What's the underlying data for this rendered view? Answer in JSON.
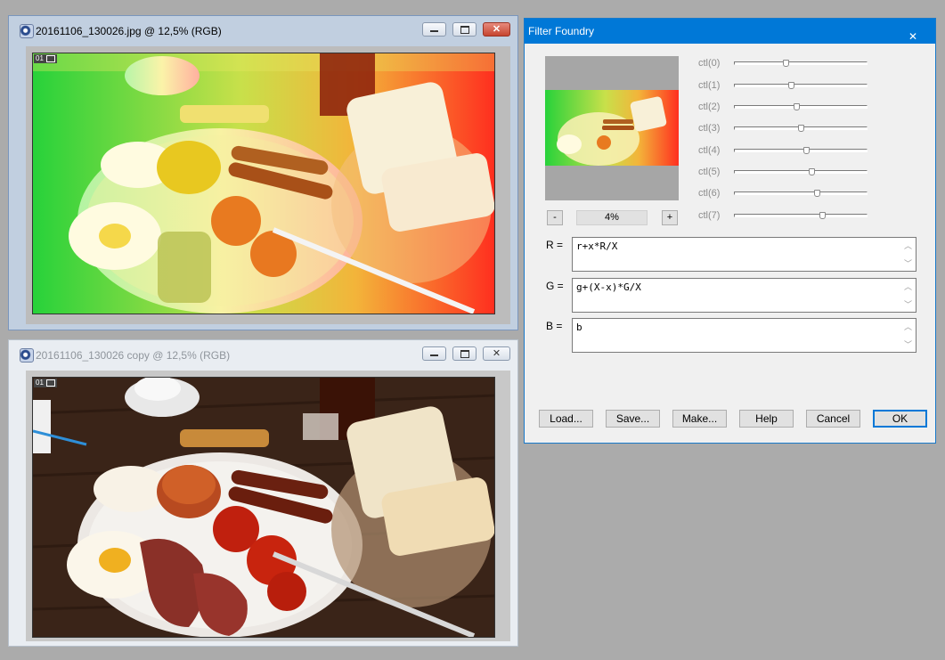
{
  "windows": [
    {
      "title": "20161106_130026.jpg @ 12,5% (RGB)",
      "layer_badge": "01",
      "active": true
    },
    {
      "title": "20161106_130026 copy @ 12,5% (RGB)",
      "layer_badge": "01",
      "active": false
    }
  ],
  "window_controls": {
    "minimize": "minimize-icon",
    "maximize": "maximize-icon",
    "close": "close-icon"
  },
  "dialog": {
    "title": "Filter Foundry",
    "close_icon": "close-icon",
    "zoom": {
      "minus": "-",
      "value": "4%",
      "plus": "+"
    },
    "controls": [
      {
        "label": "ctl(0)",
        "value": 0.39
      },
      {
        "label": "ctl(1)",
        "value": 0.43
      },
      {
        "label": "ctl(2)",
        "value": 0.47
      },
      {
        "label": "ctl(3)",
        "value": 0.51
      },
      {
        "label": "ctl(4)",
        "value": 0.55
      },
      {
        "label": "ctl(5)",
        "value": 0.59
      },
      {
        "label": "ctl(6)",
        "value": 0.63
      },
      {
        "label": "ctl(7)",
        "value": 0.67
      }
    ],
    "expressions": [
      {
        "label": "R =",
        "value": "r+x*R/X"
      },
      {
        "label": "G =",
        "value": "g+(X-x)*G/X"
      },
      {
        "label": "B =",
        "value": "b"
      }
    ],
    "buttons": [
      "Load...",
      "Save...",
      "Make...",
      "Help",
      "Cancel",
      "OK"
    ],
    "accent": "#0078d7"
  }
}
